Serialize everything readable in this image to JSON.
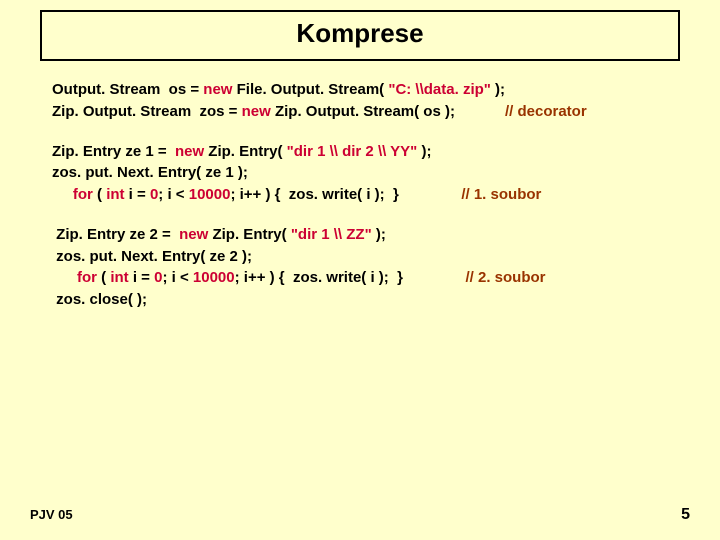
{
  "title": "Komprese",
  "code": {
    "b1": {
      "l1a": "Output. Stream  os = ",
      "l1b": "new",
      "l1c": " File. Output. Stream( ",
      "l1d": "\"C: \\\\data. zip\"",
      "l1e": " );",
      "l2a": "Zip. Output. Stream  zos = ",
      "l2b": "new",
      "l2c": " Zip. Output. Stream( os );",
      "l2d": "            // decorator"
    },
    "b2": {
      "l1a": "Zip. Entry ze 1 =  ",
      "l1b": "new",
      "l1c": " Zip. Entry( ",
      "l1d": "\"dir 1 \\\\ dir 2 \\\\ YY\"",
      "l1e": " );",
      "l2": "zos. put. Next. Entry( ze 1 );",
      "l3a": "     for",
      "l3b": " ( ",
      "l3c": "int",
      "l3d": " i = ",
      "l3e": "0",
      "l3f": "; i < ",
      "l3g": "10000",
      "l3h": "; i++ ) {  zos. write( i );  }",
      "l3i": "               // 1. soubor"
    },
    "b3": {
      "l1a": " Zip. Entry ze 2 =  ",
      "l1b": "new",
      "l1c": " Zip. Entry( ",
      "l1d": "\"dir 1 \\\\ ZZ\"",
      "l1e": " );",
      "l2": " zos. put. Next. Entry( ze 2 );",
      "l3a": "      for",
      "l3b": " ( ",
      "l3c": "int",
      "l3d": " i = ",
      "l3e": "0",
      "l3f": "; i < ",
      "l3g": "10000",
      "l3h": "; i++ ) {  zos. write( i );  }",
      "l3i": "               // 2. soubor",
      "l4": " zos. close( );"
    }
  },
  "footer_left": "PJV 05",
  "footer_right": "5"
}
